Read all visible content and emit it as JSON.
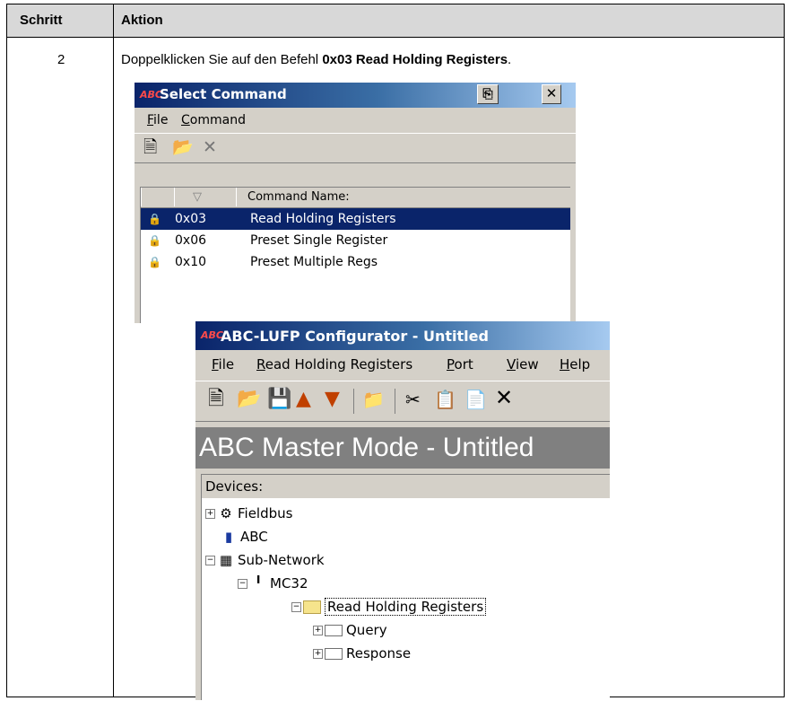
{
  "table": {
    "header": {
      "step": "Schritt",
      "action": "Aktion"
    },
    "step_number": "2",
    "action_prefix": "Doppelklicken Sie auf den Befehl ",
    "action_bold": "0x03 Read Holding Registers",
    "action_suffix": "."
  },
  "select_command": {
    "app_icon_text": "ABC",
    "title": "Select Command",
    "menu": [
      {
        "key": "F",
        "rest": "ile"
      },
      {
        "key": "C",
        "rest": "ommand"
      }
    ],
    "toolbar_icons": [
      "new-icon",
      "open-icon",
      "delete-icon"
    ],
    "column_header": "Command Name:",
    "rows": [
      {
        "code": "0x03",
        "name": "Read Holding Registers",
        "selected": true
      },
      {
        "code": "0x06",
        "name": "Preset Single Register",
        "selected": false
      },
      {
        "code": "0x10",
        "name": "Preset Multiple Regs",
        "selected": false
      }
    ]
  },
  "configurator": {
    "app_icon_text": "ABC",
    "title": "ABC-LUFP Configurator - Untitled",
    "menu": [
      {
        "key": "F",
        "rest": "ile"
      },
      {
        "key": "R",
        "rest": "ead Holding Registers"
      },
      {
        "key": "P",
        "rest": "ort"
      },
      {
        "key": "V",
        "rest": "iew"
      },
      {
        "key": "H",
        "rest": "elp"
      }
    ],
    "banner": "ABC Master Mode - Untitled",
    "devices_label": "Devices:",
    "tree": {
      "fieldbus": "Fieldbus",
      "abc": "ABC",
      "subnetwork": "Sub-Network",
      "mc32": "MC32",
      "read_holding": "Read Holding Registers",
      "query": "Query",
      "response": "Response"
    }
  }
}
